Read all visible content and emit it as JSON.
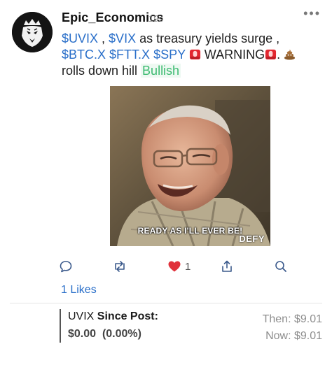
{
  "post": {
    "username": "Epic_Economics",
    "timestamp": "19s",
    "more_label": "•••",
    "body": {
      "t1": "$UVIX",
      "s1": " , ",
      "t2": "$VIX",
      "s2": " as treasury yields surge , ",
      "t3": "$BTC.X",
      "t4": "$FTT.X",
      "s4": " ",
      "t5": "$SPY",
      "s5": " ",
      "emoji_siren": "siren-emoji",
      "warning": " WARNING",
      "s6": ". ",
      "emoji_poop": "poop-emoji",
      "s7": " rolls down hill ",
      "sentiment": "Bullish"
    },
    "media": {
      "caption": "READY AS I'LL EVER BE!",
      "brand": "DEFY"
    },
    "actions": {
      "reply_icon": "comment-icon",
      "reshare_icon": "reshare-icon",
      "like_icon": "heart-icon",
      "like_count": "1",
      "share_icon": "share-icon",
      "search_icon": "search-icon"
    },
    "likes_link": "1 Likes"
  },
  "quote": {
    "symbol": "UVIX",
    "label": "Since Post:",
    "change": "$0.00",
    "change_pct": "(0.00%)",
    "then": "Then: $9.01",
    "now": "Now: $9.01"
  },
  "colors": {
    "ticker": "#2a6fc9",
    "bullish": "#3dbb71",
    "heart": "#e0313b"
  }
}
